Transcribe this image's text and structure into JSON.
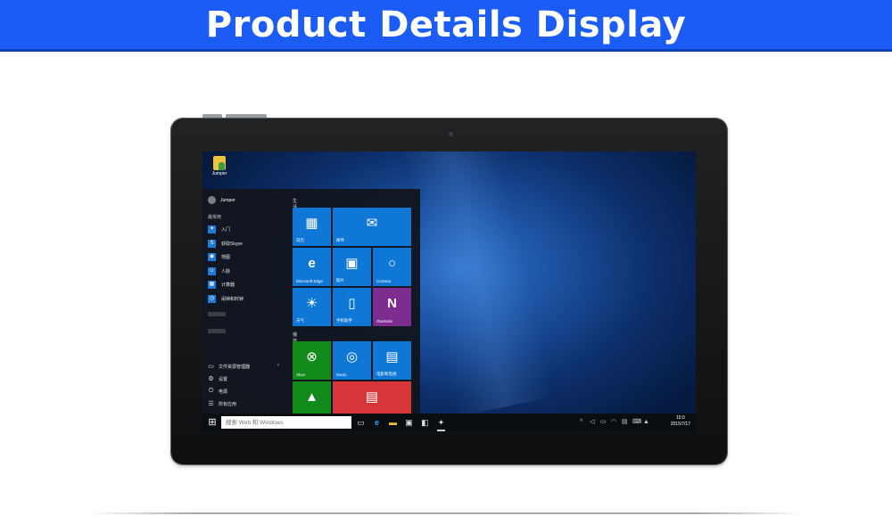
{
  "banner": {
    "title": "Product Details Display",
    "color": "#1a5cf5"
  },
  "desktop": {
    "icon_label": "Jumper"
  },
  "start_menu": {
    "user_name": "Jumper",
    "most_used_label": "最常用",
    "apps": [
      {
        "label": "入门",
        "icon": "lightbulb-icon"
      },
      {
        "label": "获取Skype",
        "icon": "skype-icon"
      },
      {
        "label": "地图",
        "icon": "map-icon"
      },
      {
        "label": "人脉",
        "icon": "people-icon"
      },
      {
        "label": "计算器",
        "icon": "calculator-icon"
      },
      {
        "label": "闹钟和时钟",
        "icon": "alarm-icon"
      }
    ],
    "bottom_items": [
      {
        "label": "文件资源管理器",
        "icon": "folder-icon"
      },
      {
        "label": "设置",
        "icon": "gear-icon"
      },
      {
        "label": "电源",
        "icon": "power-icon"
      },
      {
        "label": "所有应用",
        "icon": "list-icon"
      }
    ],
    "group1_label": "生活动态",
    "group2_label": "播放和浏览",
    "tiles": {
      "calendar": "日历",
      "mail": "邮件",
      "edge": "Microsoft Edge",
      "photos": "照片",
      "cortana": "Cortana",
      "weather": "天气",
      "phone": "手机助手",
      "onenote": "OneNote",
      "xbox": "Xbox",
      "music": "Music",
      "movies": "电影和电视"
    },
    "tile_color": "#0f78d7",
    "onenote_color": "#7d2d8f",
    "xbox_color": "#138a1c",
    "news_color": "#d6363a"
  },
  "taskbar": {
    "search_placeholder": "搜索 Web 和 Windows",
    "time": "15:0",
    "date": "2015/7/17"
  }
}
